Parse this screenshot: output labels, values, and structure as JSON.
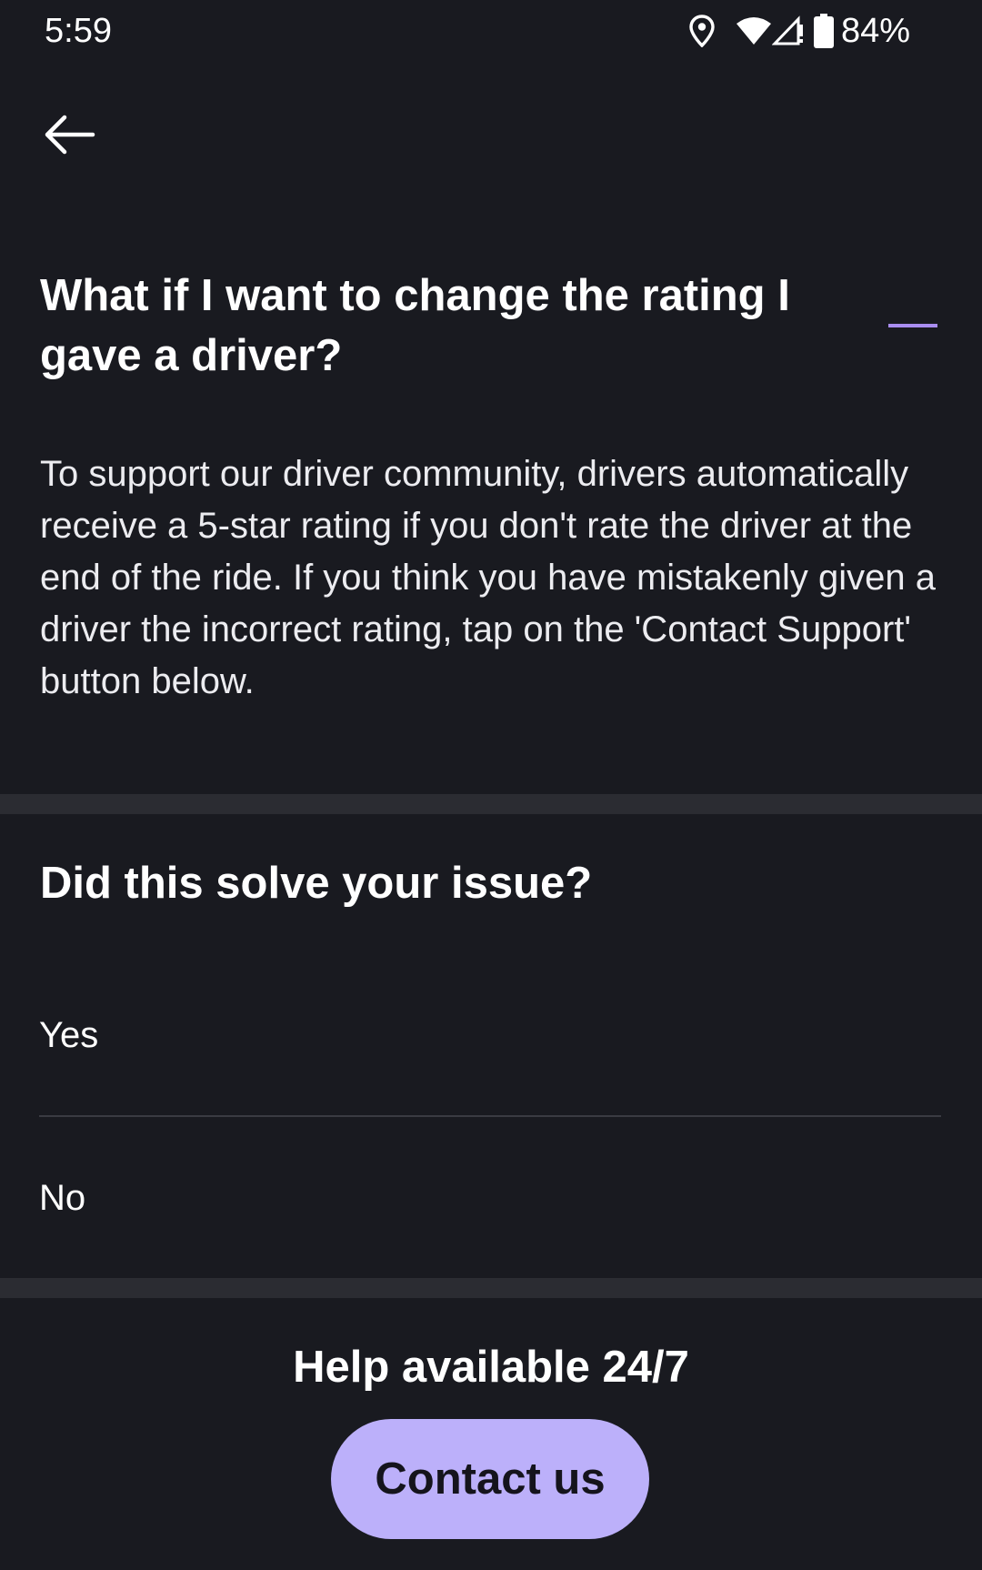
{
  "status_bar": {
    "time": "5:59",
    "battery_percent": "84%",
    "icons": [
      "location-icon",
      "wifi-icon",
      "cell-signal-icon",
      "battery-icon"
    ]
  },
  "header": {
    "back_icon": "arrow-left-icon"
  },
  "article": {
    "title": "What if I want to change the rating I gave a driver?",
    "body": "To support our driver community, drivers automatically receive a 5-star rating if you don't rate the driver at the end of the ride. If you think you have mistakenly given a driver the incorrect rating, tap on the 'Contact Support' button below."
  },
  "feedback": {
    "question": "Did this solve your issue?",
    "options": [
      {
        "label": "Yes"
      },
      {
        "label": "No"
      }
    ]
  },
  "help": {
    "title": "Help available 24/7",
    "contact_label": "Contact us"
  },
  "colors": {
    "background": "#191a20",
    "divider": "#2b2c32",
    "accent": "#a98df0",
    "button": "#bcb0fa",
    "button_text": "#15141c"
  }
}
